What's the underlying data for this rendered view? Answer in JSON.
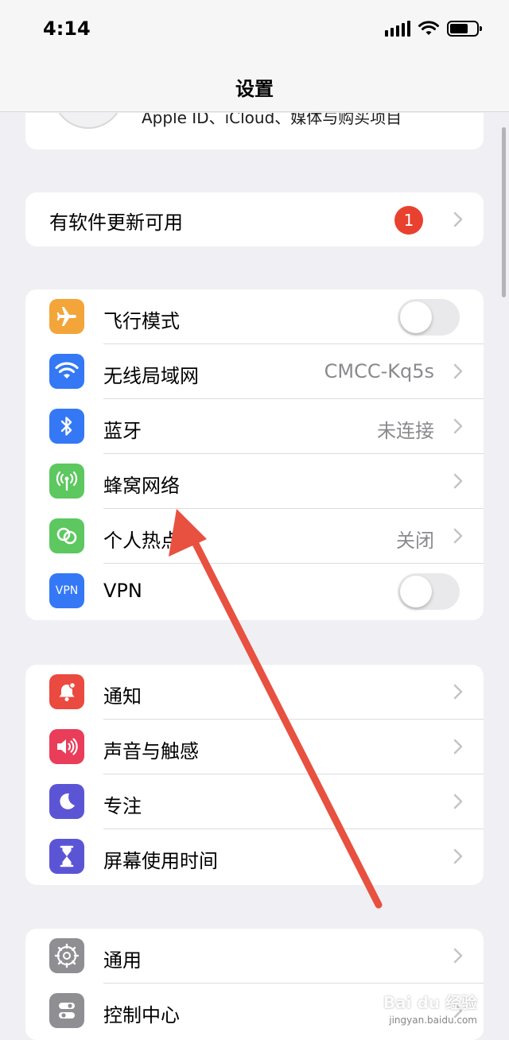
{
  "status": {
    "time": "4:14"
  },
  "nav": {
    "title": "设置"
  },
  "apple_id": {
    "text": "Apple ID、iCloud、媒体与购买项目"
  },
  "update": {
    "label": "有软件更新可用",
    "badge": "1"
  },
  "network": [
    {
      "label": "飞行模式",
      "icon": "airplane-icon",
      "color": "#f3a53a",
      "toggle": false
    },
    {
      "label": "无线局域网",
      "icon": "wifi-icon",
      "color": "#3478f6",
      "value": "CMCC-Kq5s"
    },
    {
      "label": "蓝牙",
      "icon": "bluetooth-icon",
      "color": "#3478f6",
      "value": "未连接"
    },
    {
      "label": "蜂窝网络",
      "icon": "cellular-icon",
      "color": "#5cc85f"
    },
    {
      "label": "个人热点",
      "icon": "hotspot-icon",
      "color": "#5cc85f",
      "value": "关闭"
    },
    {
      "label": "VPN",
      "icon": "vpn-icon",
      "color": "#3478f6",
      "toggle": false,
      "icon_text": "VPN"
    }
  ],
  "notifications": [
    {
      "label": "通知",
      "icon": "notifications-icon",
      "color": "#ea4a3f"
    },
    {
      "label": "声音与触感",
      "icon": "sound-icon",
      "color": "#ea3d5a"
    },
    {
      "label": "专注",
      "icon": "focus-moon-icon",
      "color": "#5b55d6"
    },
    {
      "label": "屏幕使用时间",
      "icon": "screen-time-icon",
      "color": "#5b55d6"
    }
  ],
  "general": [
    {
      "label": "通用",
      "icon": "gear-icon",
      "color": "#8e8e93"
    },
    {
      "label": "控制中心",
      "icon": "control-center-icon",
      "color": "#8e8e93"
    }
  ],
  "watermark": {
    "text": "Bai du 经验",
    "sub": "jingyan.baidu.com"
  }
}
